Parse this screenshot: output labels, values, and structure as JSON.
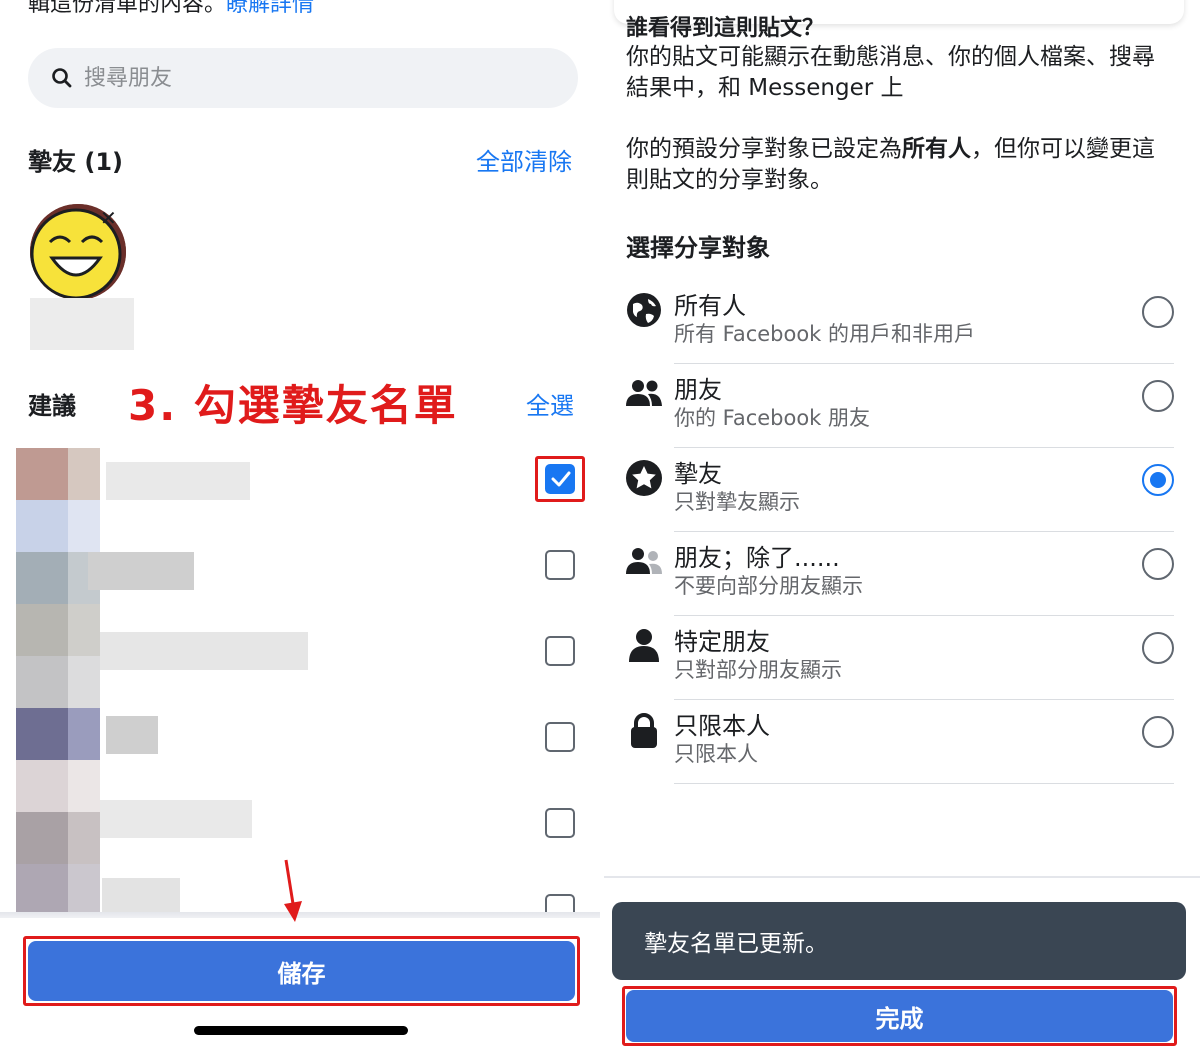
{
  "left": {
    "top_text": "輯這份清單的內容。",
    "top_link": "瞭解詳情",
    "search_placeholder": "搜尋朋友",
    "close_friends_header": "摯友 (1)",
    "clear_all": "全部清除",
    "suggestions_header": "建議",
    "annotation": "3. 勾選摯友名單",
    "select_all": "全選",
    "save_button": "儲存",
    "rows": [
      {
        "checked": true
      },
      {
        "checked": false
      },
      {
        "checked": false
      },
      {
        "checked": false
      },
      {
        "checked": false
      },
      {
        "checked": false
      }
    ]
  },
  "right": {
    "cut_title": "誰看得到這則貼文？",
    "para1": "你的貼文可能顯示在動態消息、你的個人檔案、搜尋結果中，和 Messenger 上",
    "para2_a": "你的預設分享對象已設定為",
    "para2_bold": "所有人",
    "para2_b": "，但你可以變更這則貼文的分享對象。",
    "heading": "選擇分享對象",
    "options": [
      {
        "title": "所有人",
        "sub": "所有 Facebook 的用戶和非用戶",
        "icon": "globe-icon",
        "selected": false
      },
      {
        "title": "朋友",
        "sub": "你的 Facebook 朋友",
        "icon": "friends-icon",
        "selected": false
      },
      {
        "title": "摯友",
        "sub": "只對摯友顯示",
        "icon": "star-icon",
        "selected": true
      },
      {
        "title": "朋友；除了......",
        "sub": "不要向部分朋友顯示",
        "icon": "friends-except-icon",
        "selected": false
      },
      {
        "title": "特定朋友",
        "sub": "只對部分朋友顯示",
        "icon": "person-icon",
        "selected": false
      },
      {
        "title": "只限本人",
        "sub": "只限本人",
        "icon": "lock-icon",
        "selected": false
      }
    ],
    "toast": "摯友名單已更新。",
    "done_button": "完成"
  },
  "colors": {
    "primary": "#3b73db",
    "link": "#1877f2",
    "annotation_red": "#e01b1b",
    "toast_bg": "#3a4653"
  }
}
